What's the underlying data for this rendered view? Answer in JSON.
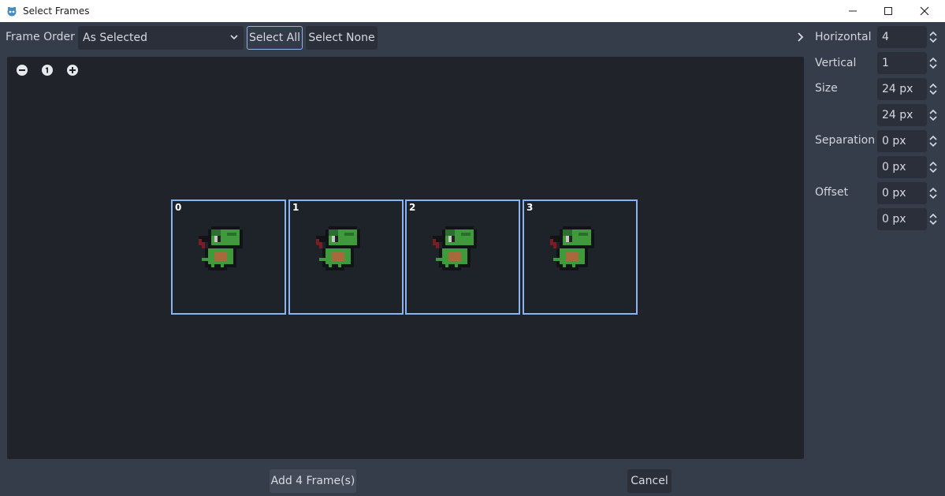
{
  "window": {
    "title": "Select Frames",
    "icon": "godot-icon",
    "controls": [
      "minimize-icon",
      "maximize-icon",
      "close-icon"
    ]
  },
  "toolbar": {
    "frame_order_label": "Frame Order",
    "frame_order_value": "As Selected",
    "select_all_label": "Select All",
    "select_none_label": "Select None"
  },
  "zoom": {
    "icons": [
      "zoom-out-icon",
      "zoom-reset-icon",
      "zoom-in-icon"
    ]
  },
  "frames": [
    {
      "index": "0"
    },
    {
      "index": "1"
    },
    {
      "index": "2"
    },
    {
      "index": "3"
    }
  ],
  "settings": {
    "horizontal_label": "Horizontal",
    "horizontal_value": "4",
    "vertical_label": "Vertical",
    "vertical_value": "1",
    "size_label": "Size",
    "size_x": "24 px",
    "size_y": "24 px",
    "separation_label": "Separation",
    "separation_x": "0 px",
    "separation_y": "0 px",
    "offset_label": "Offset",
    "offset_x": "0 px",
    "offset_y": "0 px"
  },
  "footer": {
    "add_label": "Add 4 Frame(s)",
    "cancel_label": "Cancel"
  },
  "colors": {
    "background": "#363d4a",
    "canvas": "#20232a",
    "frame_border": "#8ab4f0",
    "sprite_green": "#3e9a3a",
    "sprite_dark_green": "#2b6f2f",
    "sprite_belly": "#a86a3c",
    "sprite_outline": "#111316"
  }
}
